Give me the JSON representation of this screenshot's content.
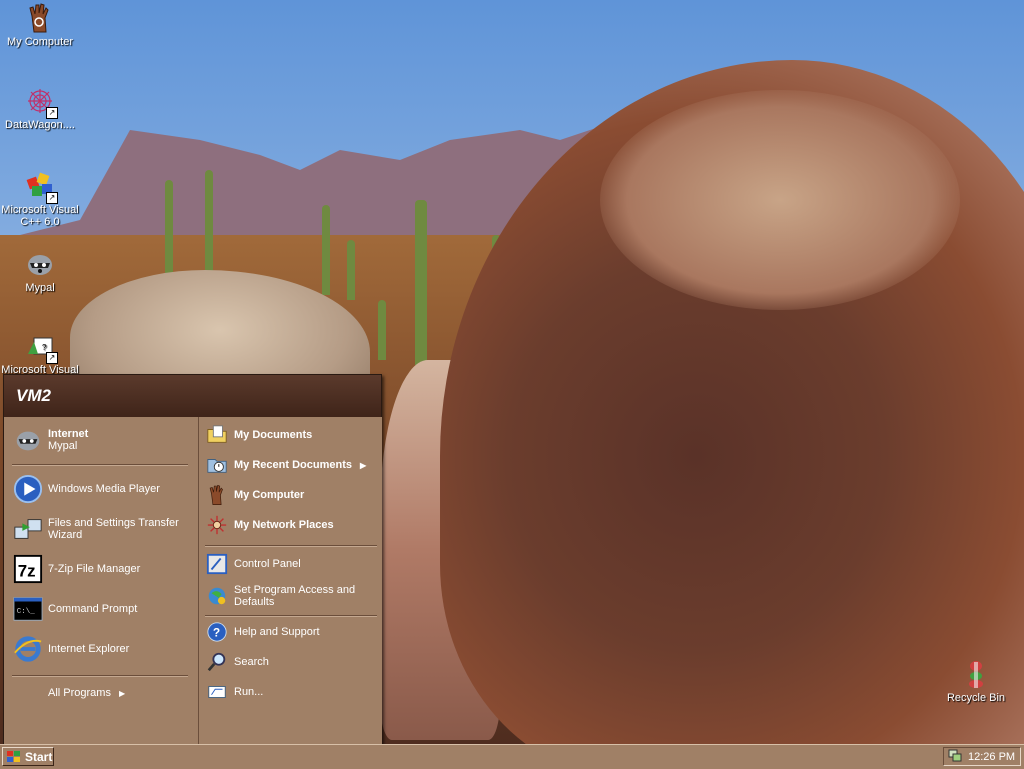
{
  "desktop": {
    "icons": [
      {
        "label": "My Computer",
        "icon": "my-computer-icon"
      },
      {
        "label": "DataWagon....",
        "icon": "datawagon-icon"
      },
      {
        "label": "Microsoft Visual C++ 6.0",
        "line1": "Microsoft Visual",
        "line2": "C++ 6.0",
        "icon": "visual-cpp-icon"
      },
      {
        "label": "Mypal",
        "icon": "mypal-icon"
      },
      {
        "label": "Microsoft Visual",
        "icon": "visual-studio-tool-icon"
      },
      {
        "label": "Recycle Bin",
        "icon": "recycle-bin-icon"
      }
    ]
  },
  "start_menu": {
    "user": "VM2",
    "pinned": {
      "title": "Internet",
      "subtitle": "Mypal"
    },
    "left_items": [
      {
        "label": "Windows Media Player"
      },
      {
        "label": "Files and Settings Transfer Wizard",
        "line1": "Files and Settings Transfer",
        "line2": "Wizard"
      },
      {
        "label": "7-Zip File Manager"
      },
      {
        "label": "Command Prompt"
      },
      {
        "label": "Internet Explorer"
      }
    ],
    "all_programs": "All Programs",
    "right_items": [
      {
        "label": "My Documents"
      },
      {
        "label": "My Recent Documents"
      },
      {
        "label": "My Computer"
      },
      {
        "label": "My Network Places"
      },
      {
        "label": "Control Panel"
      },
      {
        "label": "Set Program Access and Defaults",
        "line1": "Set Program Access and",
        "line2": "Defaults"
      },
      {
        "label": "Help and Support"
      },
      {
        "label": "Search"
      },
      {
        "label": "Run..."
      }
    ]
  },
  "taskbar": {
    "start_label": "Start",
    "clock": "12:26 PM"
  }
}
